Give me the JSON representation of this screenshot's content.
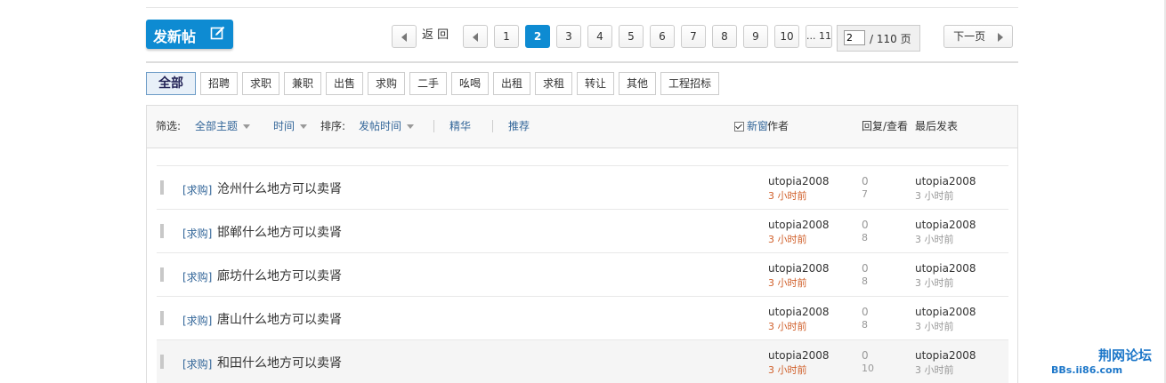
{
  "new_post": {
    "label": "发新帖",
    "icon": "edit-icon"
  },
  "pagination": {
    "back_label": "返 回",
    "pages": [
      "1",
      "2",
      "3",
      "4",
      "5",
      "6",
      "7",
      "8",
      "9",
      "10",
      "... 11"
    ],
    "current": "2",
    "jump_value": "2",
    "total_label": "/ 110 页",
    "next_label": "下一页"
  },
  "categories": [
    "全部",
    "招聘",
    "求职",
    "兼职",
    "出售",
    "求购",
    "二手",
    "吆喝",
    "出租",
    "求租",
    "转让",
    "其他",
    "工程招标"
  ],
  "filter": {
    "label": "筛选:",
    "all_topics": "全部主题",
    "time": "时间",
    "sort_label": "排序:",
    "sort_value": "发帖时间",
    "digest": "精华",
    "recommend": "推荐",
    "new_window": "新窗",
    "author_col": "作者",
    "reply_col": "回复/查看",
    "last_post_col": "最后发表"
  },
  "threads": [
    {
      "tag": "[求购]",
      "title": "沧州什么地方可以卖肾",
      "author": "utopia2008",
      "time": "3 小时前",
      "replies": "0",
      "views": "7",
      "last_author": "utopia2008",
      "last_time": "3 小时前"
    },
    {
      "tag": "[求购]",
      "title": "邯郸什么地方可以卖肾",
      "author": "utopia2008",
      "time": "3 小时前",
      "replies": "0",
      "views": "8",
      "last_author": "utopia2008",
      "last_time": "3 小时前"
    },
    {
      "tag": "[求购]",
      "title": "廊坊什么地方可以卖肾",
      "author": "utopia2008",
      "time": "3 小时前",
      "replies": "0",
      "views": "8",
      "last_author": "utopia2008",
      "last_time": "3 小时前"
    },
    {
      "tag": "[求购]",
      "title": "唐山什么地方可以卖肾",
      "author": "utopia2008",
      "time": "3 小时前",
      "replies": "0",
      "views": "8",
      "last_author": "utopia2008",
      "last_time": "3 小时前"
    },
    {
      "tag": "[求购]",
      "title": "和田什么地方可以卖肾",
      "author": "utopia2008",
      "time": "3 小时前",
      "replies": "0",
      "views": "10",
      "last_author": "utopia2008",
      "last_time": "3 小时前"
    }
  ],
  "watermark": {
    "line1": "荆网论坛",
    "line2": "BBs.ii86.com"
  },
  "colors": {
    "accent": "#0e8bd2",
    "link": "#336699",
    "time": "#d0602b"
  }
}
